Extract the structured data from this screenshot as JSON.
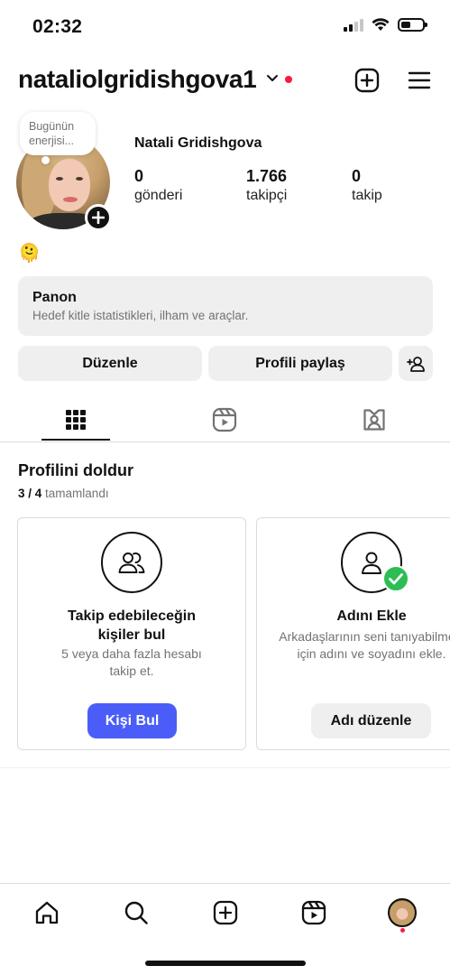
{
  "status_bar": {
    "time": "02:32"
  },
  "header": {
    "username": "nataliolgridishgova1"
  },
  "profile": {
    "note": "Bugünün enerjisi...",
    "full_name": "Natali Gridishgova",
    "stats": [
      {
        "number": "0",
        "label": "gönderi"
      },
      {
        "number": "1.766",
        "label": "takipçi"
      },
      {
        "number": "0",
        "label": "takip"
      }
    ],
    "bio_emoji": "🫠"
  },
  "dashboard": {
    "title": "Panon",
    "subtitle": "Hedef kitle istatistikleri, ilham ve araçlar."
  },
  "actions": {
    "edit_label": "Düzenle",
    "share_label": "Profili paylaş"
  },
  "complete_profile": {
    "title": "Profilini doldur",
    "progress": "3 / 4",
    "progress_suffix": "tamamlandı",
    "cards": [
      {
        "title_line1": "Takip edebileceğin",
        "title_line2": "kişiler bul",
        "text_line1": "5 veya daha fazla hesabı",
        "text_line2": "takip et.",
        "button": "Kişi Bul"
      },
      {
        "title_line1": "Adını Ekle",
        "text_line1": "Arkadaşlarının seni tanıyabilmesi",
        "text_line2": "için adını ve soyadını ekle.",
        "button": "Adı düzenle"
      }
    ]
  },
  "colors": {
    "primary_button": "#4a5df9",
    "notification_red": "#ff1744",
    "check_green": "#2dbd55",
    "surface_gray": "#efefef"
  },
  "icons": [
    "wifi-icon",
    "plus-square-icon",
    "hamburger-menu-icon",
    "grid-icon",
    "reels-icon",
    "tagged-icon",
    "home-icon",
    "search-icon",
    "create-icon",
    "reels-nav-icon"
  ]
}
